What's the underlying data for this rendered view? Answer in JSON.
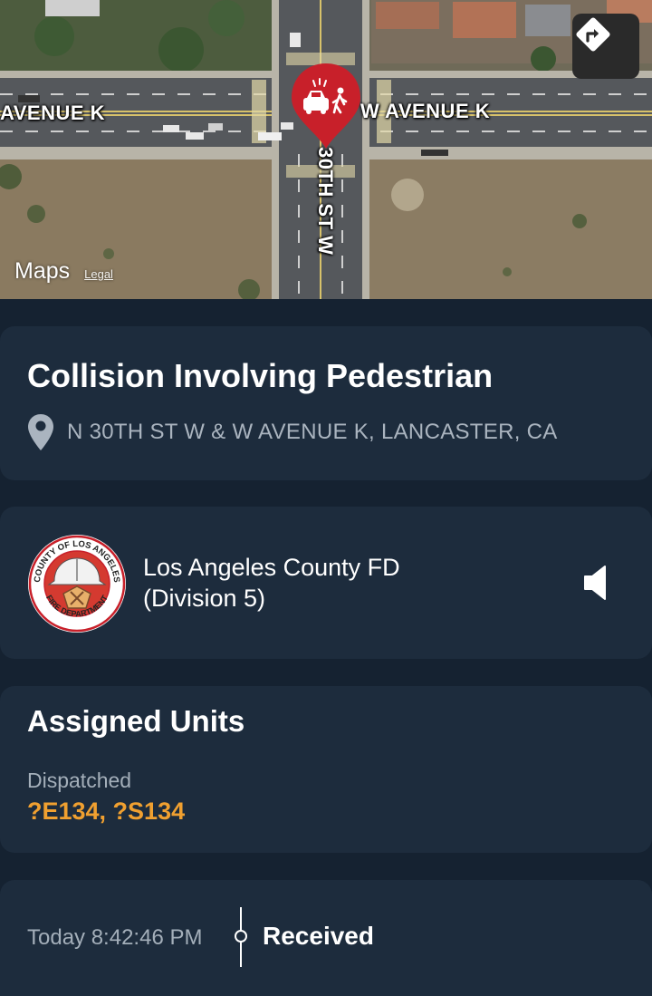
{
  "map": {
    "road_west": "AVENUE K",
    "road_east": "W AVENUE K",
    "road_vertical": "30TH ST W",
    "maps_brand": "Maps",
    "legal_label": "Legal",
    "pin_icon": "collision-pedestrian-icon",
    "pin_color": "#c8202a"
  },
  "incident": {
    "title": "Collision Involving Pedestrian",
    "location": "N 30TH ST W & W AVENUE K, LANCASTER, CA"
  },
  "agency": {
    "name_line1": "Los Angeles County FD",
    "name_line2": "(Division 5)",
    "logo_ring_text": "COUNTY OF LOS ANGELES",
    "logo_bottom_text": "FIRE DEPARTMENT"
  },
  "units": {
    "title": "Assigned Units",
    "status_label": "Dispatched",
    "values": "?E134, ?S134",
    "accent_color": "#f0a030"
  },
  "timeline": {
    "time": "Today 8:42:46 PM",
    "status": "Received"
  }
}
